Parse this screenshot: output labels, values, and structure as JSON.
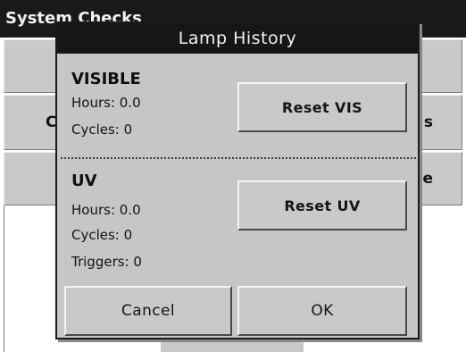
{
  "background_window": {
    "title": "System Checks",
    "button_row_2_left": "C",
    "button_row_2_right": "s",
    "button_row_3_right": "te"
  },
  "dialog": {
    "title": "Lamp History",
    "visible": {
      "heading": "VISIBLE",
      "hours": "Hours: 0.0",
      "cycles": "Cycles: 0",
      "reset_label": "Reset VIS"
    },
    "uv": {
      "heading": "UV",
      "hours": "Hours: 0.0",
      "cycles": "Cycles: 0",
      "triggers": "Triggers: 0",
      "reset_label": "Reset UV"
    },
    "cancel_label": "Cancel",
    "ok_label": "OK"
  }
}
